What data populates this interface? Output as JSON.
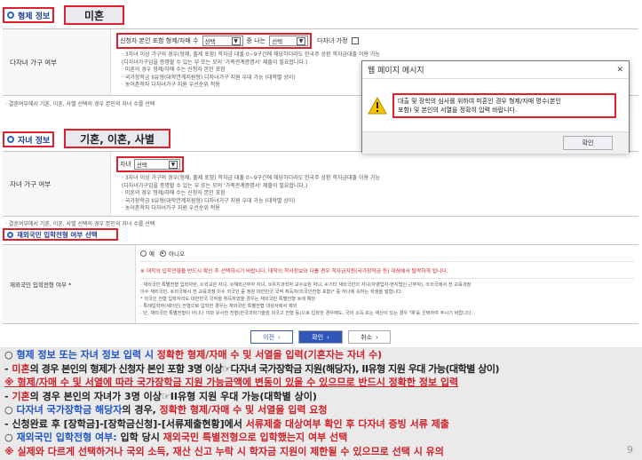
{
  "sibling": {
    "title": "형제 정보",
    "callout": "미혼",
    "row_label": "다자녀 가구 여부",
    "field_prefix": "신청자 본인 포함 형제/자매 수",
    "select1": "선택",
    "mid_text": "중 나는",
    "select2": "선택",
    "checkbox_label": "다자녀 가정",
    "bullets": [
      "· 3자녀 이상 가구의 경우(형제, 출제 포함) 학자금 대출 0~9구간에 해당하더라도 한국주 상환 학자금대출 이용 가능",
      "  (다자녀가구임을 증명할 수 있는 부 또는 모의 '가족관계증명서' 제출이 필요합니다.)",
      "· 미혼의 경우 형제/자매 수는 신청자 본인 포함",
      "· 국가장학금 II유형(대학연계지원형) 다자녀가구 지원 우대 가능 (대학별 상이)",
      "· 농어촌학자 다자녀가구 지원 우선순위 적용"
    ],
    "note": "· 결혼여부에서 기혼, 이혼, 사별 선택의 경우 본인의 자녀 수를 선택"
  },
  "children": {
    "title": "자녀 정보",
    "callout": "기혼, 이혼, 사별",
    "row_label": "자녀 가구 여부",
    "field_prefix": "자녀",
    "select1": "선택",
    "bullets": [
      "· 3자녀 이상 가구의 경우(형제, 출제 포함) 학자금 대출 0~9구간에 해당하더라도 한국주 상환 학자금대출 이용 가능",
      "  (다자녀가구임을 증명할 수 있는 부 또는 모의 '가족관계증명서' 제출이 필요합니다.)",
      "· 미혼의 경우 형제/자매 수는 신청자 본인 포함",
      "· 국가장학금 II유형(대학연계지원형) 다자녀가구 지원 우대 가능 (대학별 상이)",
      "· 농어촌학자 다자녀가구 지원 우선순위 적용"
    ],
    "note": "· 결혼여부에서 기혼, 이혼, 사별 선택의 경우 본인의 자녀 수를 선택"
  },
  "overseas": {
    "title": "재외국민 입학전형 여부 선택",
    "row_label": "재외국민 입학전형 여부 *",
    "radio_yes": "예",
    "radio_no": "아니오",
    "warning": "※ 대학의 입학전형을 반드시 확인 후 선택하시기 바랍니다. 대학의 학사정보와 다를 경우 학자금지원(국가장학금 등) 대상에서 탈락하게 됩니다.",
    "bullets": [
      "· 재외국민 특별전형 입학자란, ①외교관 자녀, ②해외근무자 자녀, ③유치과학자·교수요원 자녀, ④기타 재외국민의 자녀(자영업자·현지법인 근무자), ⑤외국에서 전 교육과정",
      "  이수 재외국민, ⑥외국에서 전 교육과정 이수 외국인 중 정원 대한민국 국적 취득자(외국인전형 포함)* 중 하나에 속하는 학생을 말합니다.",
      "  * 외국인 전형 입학자라도 대한민국 국적을 취득하였을 경우는 재외국민 특별전형 ⑥에 해당",
      "· 특례입학자(새터민) 전형으로 입학한 경우는 재외국민 특별전형 대상자에서 제외",
      "· 단, 재외국민 특별전형이 아니나 이와 유사한 전형(한국과학기술원 외국고 전형 등)으로 입학한 경우에도, 국외 소득 또는 재산이 있는 경우 '예'를 선택하여 주시기 바랍니다."
    ]
  },
  "nav": {
    "prev": "이전",
    "next": "확인",
    "cancel": "취소"
  },
  "dialog": {
    "title": "웹 페이지 메시지",
    "close": "✕",
    "message_line1": "대출 및 장학의 심사를 위하여 미혼인 경우 형제/자매 명수(본인",
    "message_line2": "포함) 및 본인의 서열을 정확히 입력 바랍니다.",
    "ok": "확인"
  },
  "bottom": {
    "l1_a": "○ ",
    "l1_b": "형제 정보 또는 자녀 정보 입력 시",
    "l1_c": " 정확한 형제/자매 수 및 서열을 입력(기혼자는 자녀 수)",
    "l2_a": " - ",
    "l2_b": "미혼",
    "l2_c": "의 경우 본인의 형제가 신청자 본인 포함 3명 이상☞다자녀 국가장학금 지원(해당자), II유형 지원 우대 가능(대학별 상이)",
    "l3": " ※ 형제/자매 수 및 서열에 따라 국가장학금 지원 가능금액에 변동이 있을 수 있으므로 반드시 정확한 정보 입력",
    "l4_a": " - ",
    "l4_b": "기혼",
    "l4_c": "의 경우 본인의 자녀가 3명 이상☞II유형 지원 우대 가능(대학별 상이)",
    "l5_a": "○ ",
    "l5_b": "다자녀 국가장학금 해당자",
    "l5_c": "의 경우, ",
    "l5_d": "정확한 형제/자매 수 및 서열을 입력 요청",
    "l6_a": " - 신청완료 후 [장학금]-[장학금신청]-[서류제출현황]에서 ",
    "l6_b": "서류제출 대상여부 확인 후 다자녀 증빙 서류 제출",
    "l7_a": "○ ",
    "l7_b": "재외국민 입학전형 여부:",
    "l7_c": " 입학 당시 ",
    "l7_d": "재외국민 특별전형으로 입학했는지 여부 선택",
    "l8": " ※ 실제와 다르게 선택하거나 국외 소득, 재산 신고 누락 시 학자금 지원이 제한될 수 있으므로 선택 시 유의",
    "page_number": "9"
  }
}
